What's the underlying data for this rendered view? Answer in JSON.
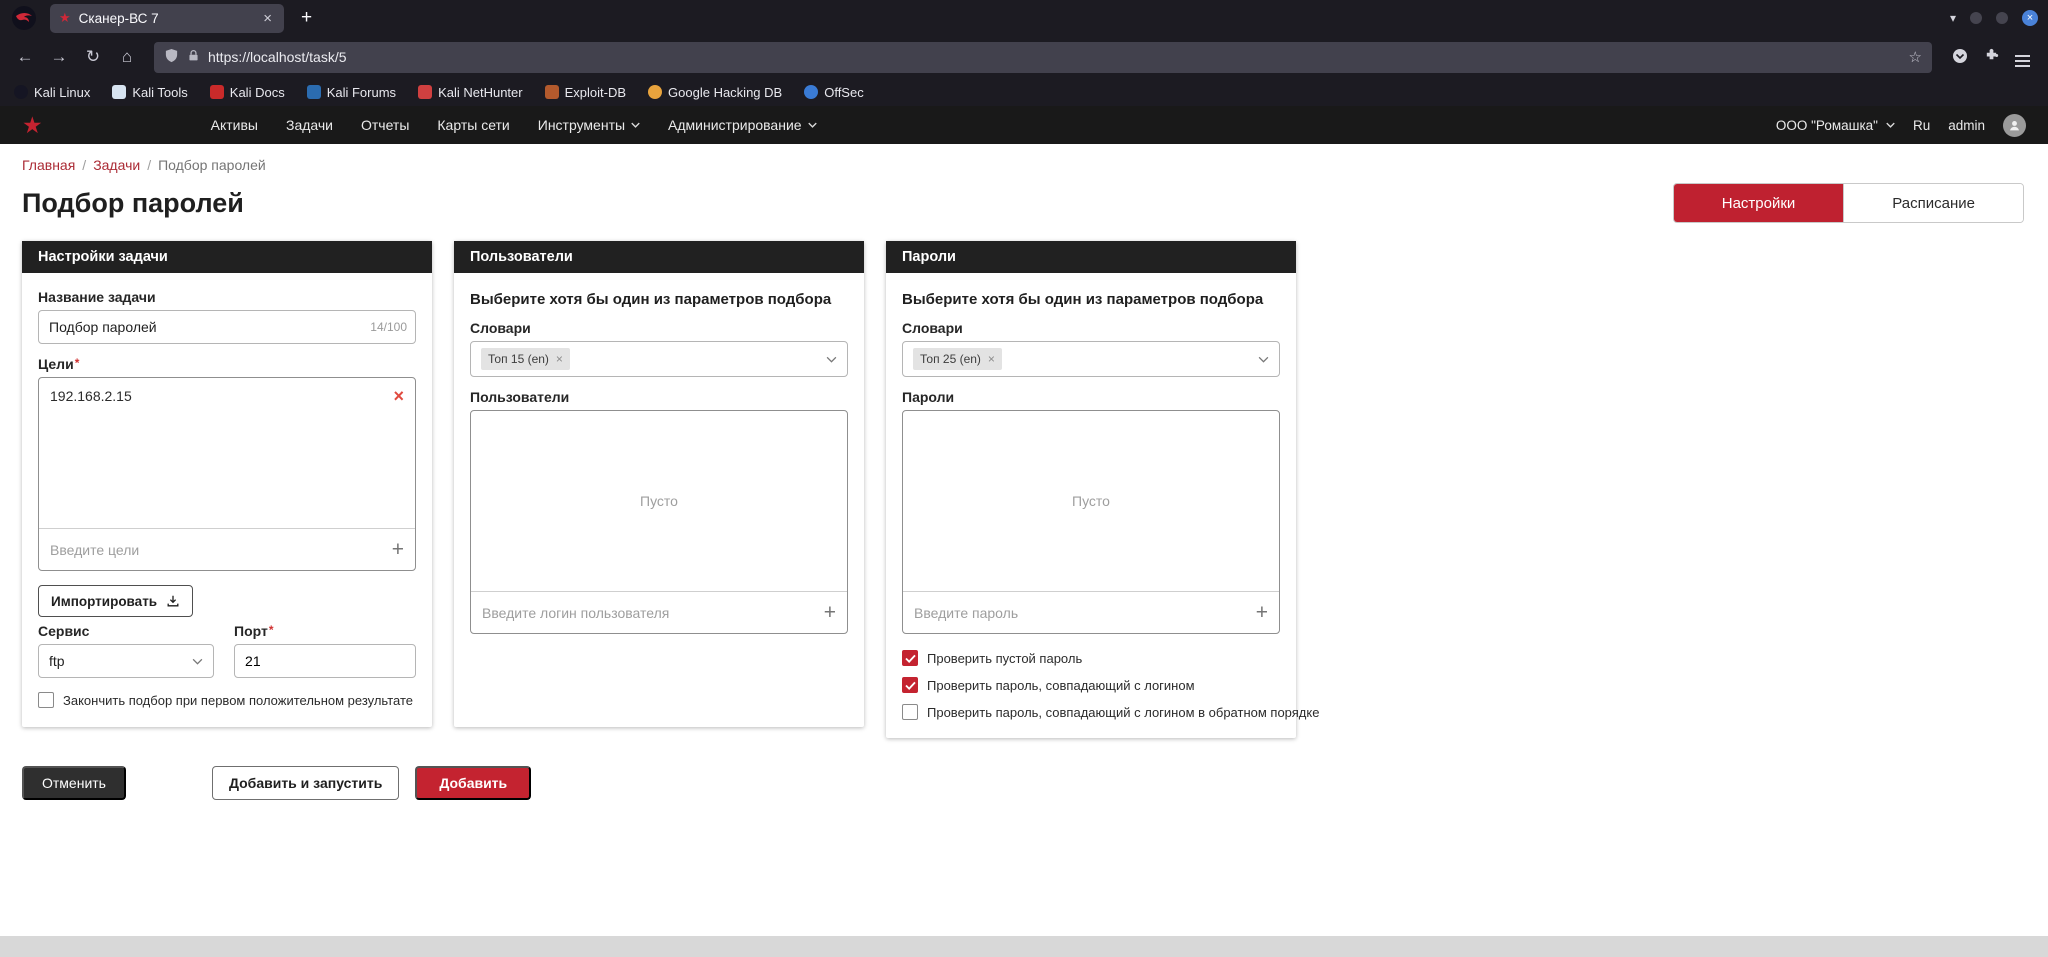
{
  "colors": {
    "accent_red": "#bf2130",
    "chrome_dark": "#1c1b22",
    "chrome_field": "#42414d",
    "card_header_bg": "#212121",
    "checkbox_checked": "#c42330"
  },
  "icons": {
    "star": "★",
    "star_outline": "☆",
    "close": "×",
    "add": "+",
    "remove": "×",
    "back": "←",
    "forward": "→",
    "reload": "↻",
    "home": "⌂",
    "list_tabs": "▾"
  },
  "browser": {
    "tab_title": "Сканер-ВС 7",
    "url": "https://localhost/task/5",
    "bookmarks": [
      "Kali Linux",
      "Kali Tools",
      "Kali Docs",
      "Kali Forums",
      "Kali NetHunter",
      "Exploit-DB",
      "Google Hacking DB",
      "OffSec"
    ]
  },
  "header": {
    "nav": [
      "Активы",
      "Задачи",
      "Отчеты",
      "Карты сети",
      "Инструменты",
      "Администрирование"
    ],
    "org": "ООО \"Ромашка\"",
    "lang": "Ru",
    "user": "admin"
  },
  "breadcrumb": {
    "separator": "/",
    "items": [
      "Главная",
      "Задачи",
      "Подбор паролей"
    ]
  },
  "page": {
    "title": "Подбор паролей",
    "required_marker": "*",
    "toggle": {
      "settings": "Настройки",
      "schedule": "Расписание"
    }
  },
  "task_card": {
    "header": "Настройки задачи",
    "name_label": "Название задачи",
    "name_value": "Подбор паролей",
    "name_counter": "14/100",
    "targets_label": "Цели",
    "target_value": "192.168.2.15",
    "targets_placeholder": "Введите цели",
    "import_button": "Импортировать",
    "service_label": "Сервис",
    "service_value": "ftp",
    "port_label": "Порт",
    "port_value": "21",
    "stop_checkbox": {
      "label": "Закончить подбор при первом положительном результате",
      "checked": false
    }
  },
  "users_card": {
    "header": "Пользователи",
    "hint": "Выберите хотя бы один из параметров подбора",
    "dicts_label": "Словари",
    "dict_chip": "Топ 15 (en)",
    "list_label": "Пользователи",
    "empty": "Пусто",
    "placeholder": "Введите логин пользователя"
  },
  "passwords_card": {
    "header": "Пароли",
    "hint": "Выберите хотя бы один из параметров подбора",
    "dicts_label": "Словари",
    "dict_chip": "Топ 25 (en)",
    "list_label": "Пароли",
    "empty": "Пусто",
    "placeholder": "Введите пароль",
    "checkboxes": [
      {
        "label": "Проверить пустой пароль",
        "checked": true
      },
      {
        "label": "Проверить пароль, совпадающий с логином",
        "checked": true
      },
      {
        "label": "Проверить пароль, совпадающий с логином в обратном порядке",
        "checked": false
      }
    ]
  },
  "actions": {
    "cancel": "Отменить",
    "add_and_run": "Добавить и запустить",
    "add": "Добавить"
  }
}
